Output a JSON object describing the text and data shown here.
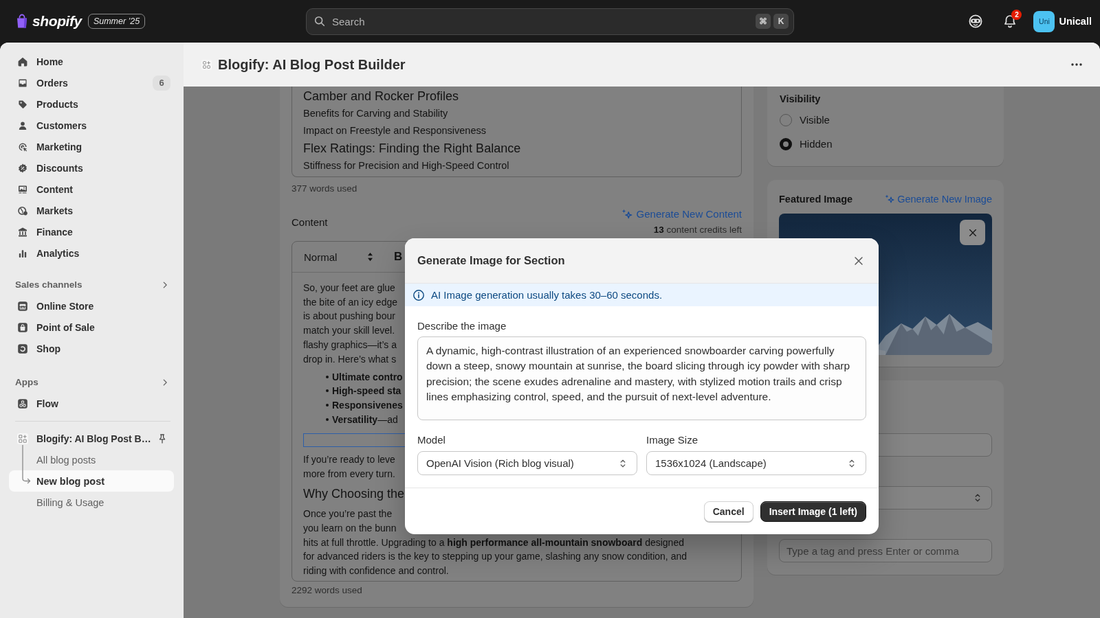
{
  "top_bar": {
    "logo": "shopify",
    "edition_badge": "Summer ’25",
    "search": {
      "placeholder": "Search",
      "shortcut_keys": [
        "⌘",
        "K"
      ]
    },
    "notification_count": "2",
    "user": {
      "initials": "Uni",
      "name": "Unicall"
    }
  },
  "sidebar": {
    "items": [
      {
        "label": "Home",
        "selected": false
      },
      {
        "label": "Orders",
        "badge": "6",
        "selected": false
      },
      {
        "label": "Products",
        "selected": false
      },
      {
        "label": "Customers",
        "selected": false
      },
      {
        "label": "Marketing",
        "selected": false
      },
      {
        "label": "Discounts",
        "selected": false
      },
      {
        "label": "Content",
        "selected": false
      },
      {
        "label": "Markets",
        "selected": false
      },
      {
        "label": "Finance",
        "selected": false
      },
      {
        "label": "Analytics",
        "selected": false
      }
    ],
    "sections": [
      {
        "title": "Sales channels",
        "items": [
          {
            "label": "Online Store",
            "selected": false
          },
          {
            "label": "Point of Sale",
            "selected": false
          },
          {
            "label": "Shop",
            "selected": false
          }
        ]
      },
      {
        "title": "Apps",
        "items": [
          {
            "label": "Flow",
            "selected": false
          }
        ]
      }
    ],
    "pinned_app": {
      "label": "Blogify: AI Blog Post B…",
      "children": [
        {
          "label": "All blog posts",
          "selected": false
        },
        {
          "label": "New blog post",
          "selected": true
        },
        {
          "label": "Billing & Usage",
          "selected": false
        }
      ]
    }
  },
  "page_header": {
    "title": "Blogify: AI Blog Post Builder"
  },
  "editor": {
    "outline": {
      "lines": [
        {
          "kind": "heading",
          "text": "Camber and Rocker Profiles"
        },
        {
          "kind": "subheading",
          "text": "Benefits for Carving and Stability"
        },
        {
          "kind": "subheading",
          "text": "Impact on Freestyle and Responsiveness"
        },
        {
          "kind": "heading",
          "text": "Flex Ratings: Finding the Right Balance"
        },
        {
          "kind": "subheading",
          "text": "Stiffness for Precision and High-Speed Control"
        }
      ],
      "word_count": "377 words used"
    },
    "content": {
      "label": "Content",
      "generate_link": "Generate New Content",
      "credits": "**13** content credits left",
      "toolbar": {
        "text_style": "Normal",
        "bold_button": "B"
      },
      "blocks": [
        {
          "kind": "text",
          "text": "So, your feet are glue"
        },
        {
          "kind": "text",
          "text": "the bite of an icy edge"
        },
        {
          "kind": "text",
          "text": "is about pushing bour"
        },
        {
          "kind": "text",
          "text": "match your skill level."
        },
        {
          "kind": "text",
          "text": "flashy graphics—it’s a"
        },
        {
          "kind": "text",
          "text": "drop in. Here’s what s"
        },
        {
          "kind": "bullet",
          "text": "**Ultimate contro**"
        },
        {
          "kind": "bullet",
          "text": "**High-speed sta**"
        },
        {
          "kind": "bullet",
          "text": "**Responsivenes**"
        },
        {
          "kind": "bullet",
          "text": "**Versatility**—ad"
        },
        {
          "kind": "empty_block"
        },
        {
          "kind": "text",
          "text": "If you’re ready to leve"
        },
        {
          "kind": "text",
          "text": "more from every turn."
        },
        {
          "kind": "heading",
          "text": "Why Choosing the"
        },
        {
          "kind": "text",
          "text": "Once you’re past the"
        },
        {
          "kind": "text",
          "text": "you learn on the bunn"
        },
        {
          "kind": "text",
          "text": "hits at full throttle. Upgrading to a **high performance all-mountain snowboard** designed"
        },
        {
          "kind": "text",
          "text": "for advanced riders is the key to stepping up your game, slashing any snow condition, and"
        },
        {
          "kind": "text",
          "text": "riding with confidence and control."
        }
      ],
      "word_count": "2292 words used"
    }
  },
  "sidebar_panel": {
    "visibility": {
      "title": "Visibility",
      "options": [
        {
          "label": "Visible",
          "selected": false
        },
        {
          "label": "Hidden",
          "selected": true
        }
      ]
    },
    "featured_image": {
      "title": "Featured Image",
      "generate_link": "Generate New Image"
    },
    "fields": [
      {
        "kind": "input"
      },
      {
        "kind": "select"
      },
      {
        "kind": "input",
        "placeholder": "Type a tag and press Enter or comma"
      }
    ]
  },
  "modal": {
    "title": "Generate Image for Section",
    "notice": "AI Image generation usually takes 30–60 seconds.",
    "description": {
      "label": "Describe the image",
      "value": "A dynamic, high-contrast illustration of an experienced snowboarder carving powerfully down a steep, snowy mountain at sunrise, the board slicing through icy powder with sharp precision; the scene exudes adrenaline and mastery, with stylized motion trails and crisp lines emphasizing control, speed, and the pursuit of next-level adventure."
    },
    "model": {
      "label": "Model",
      "value": "OpenAI Vision (Rich blog visual)"
    },
    "image_size": {
      "label": "Image Size",
      "value": "1536x1024 (Landscape)"
    },
    "buttons": [
      {
        "label": "Cancel",
        "kind": "secondary"
      },
      {
        "label": "Insert Image (1 left)",
        "kind": "primary"
      }
    ]
  }
}
